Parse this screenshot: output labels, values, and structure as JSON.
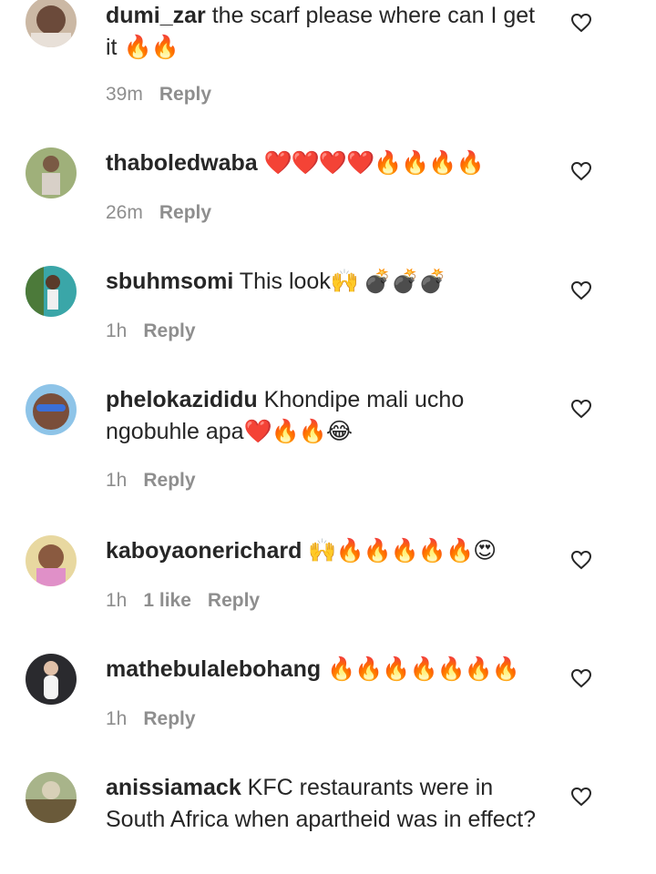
{
  "reply_label": "Reply",
  "comments": [
    {
      "username": "dumi_zar",
      "text": "the scarf please where can I get it",
      "emoji": "🔥🔥",
      "time": "39m",
      "likes": ""
    },
    {
      "username": "thaboledwaba",
      "text": "",
      "emoji": "❤️❤️❤️❤️🔥🔥🔥🔥",
      "time": "26m",
      "likes": ""
    },
    {
      "username": "sbuhmsomi",
      "text": "This look",
      "emoji": "🙌 💣💣💣",
      "time": "1h",
      "likes": ""
    },
    {
      "username": "phelokazididu",
      "text": "Khondipe mali ucho ngobuhle apa",
      "emoji": "❤️🔥🔥😂",
      "time": "1h",
      "likes": ""
    },
    {
      "username": "kaboyaonerichard",
      "text": "",
      "emoji": "🙌🔥🔥🔥🔥🔥😍",
      "time": "1h",
      "likes": "1 like"
    },
    {
      "username": "mathebulalebohang",
      "text": "",
      "emoji": "🔥🔥🔥🔥🔥🔥🔥",
      "time": "1h",
      "likes": ""
    },
    {
      "username": "anissiamack",
      "text": "KFC restaurants were in South Africa when apartheid was in effect?",
      "emoji": "",
      "time": "",
      "likes": ""
    }
  ],
  "icons": {
    "like": "heart-outline-icon",
    "avatar": "user-avatar"
  },
  "colors": {
    "text": "#262626",
    "meta": "#8e8e8e",
    "background": "#ffffff"
  }
}
